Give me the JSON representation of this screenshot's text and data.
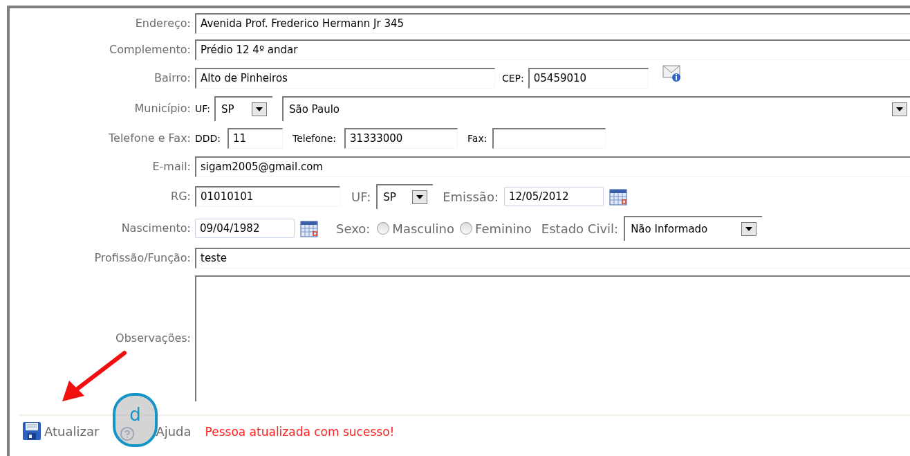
{
  "form": {
    "address": {
      "label": "Endereço:",
      "value": "Avenida Prof. Frederico Hermann Jr 345"
    },
    "complement": {
      "label": "Complemento:",
      "value": "Prédio 12 4º andar"
    },
    "district": {
      "label": "Bairro:",
      "value": "Alto de Pinheiros",
      "cep_label": "CEP:",
      "cep_value": "05459010"
    },
    "city": {
      "label": "Município:",
      "uf_label": "UF:",
      "uf_value": "SP",
      "city_value": "São Paulo"
    },
    "phone": {
      "label": "Telefone e Fax:",
      "ddd_label": "DDD:",
      "ddd_value": "11",
      "phone_label": "Telefone:",
      "phone_value": "31333000",
      "fax_label": "Fax:"
    },
    "email": {
      "label": "E-mail:",
      "value": "sigam2005@gmail.com"
    },
    "rg": {
      "label": "RG:",
      "value": "01010101",
      "uf_label": "UF:",
      "uf_value": "SP",
      "issue_label": "Emissão:",
      "issue_value": "12/05/2012"
    },
    "birth": {
      "label": "Nascimento:",
      "value": "09/04/1982",
      "sex_label": "Sexo:",
      "sex_options": [
        {
          "label": "Masculino",
          "selected": false
        },
        {
          "label": "Feminino",
          "selected": false
        }
      ],
      "marital_label": "Estado Civil:",
      "marital_value": "Não Informado"
    },
    "profession": {
      "label": "Profissão/Função:",
      "value": "teste"
    },
    "notes": {
      "label": "Observações:"
    }
  },
  "footer": {
    "update_button": "Atualizar",
    "help_button": "Ajuda",
    "message": "Pessoa atualizada com sucesso!"
  },
  "annotation": {
    "badge": "d"
  }
}
